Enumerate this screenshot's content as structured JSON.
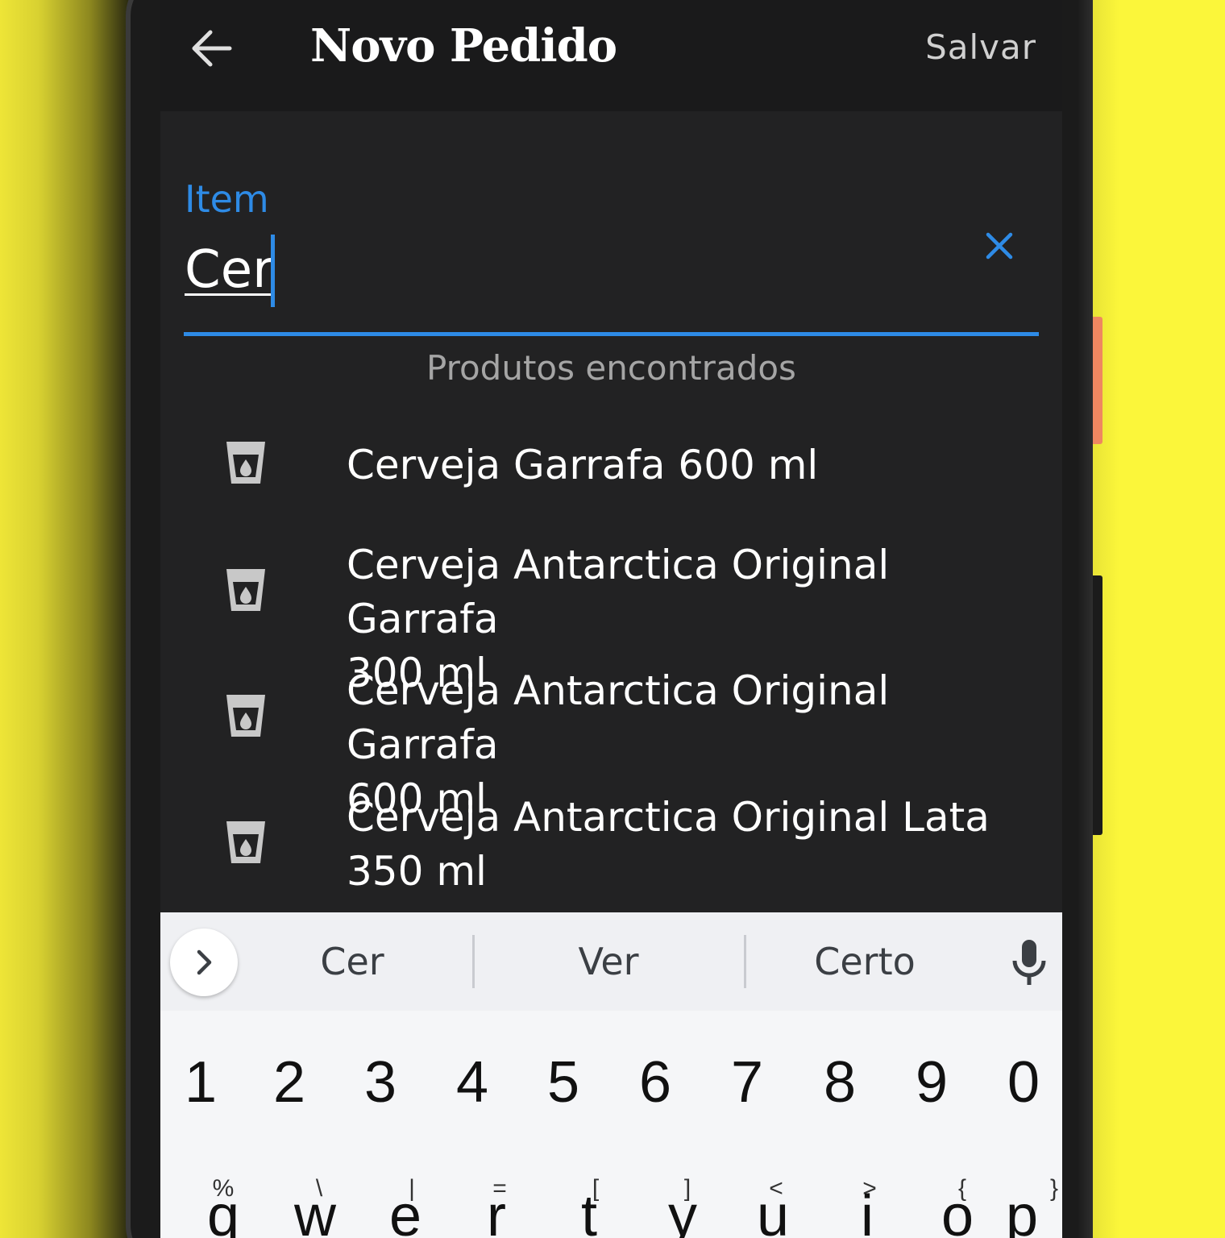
{
  "app": {
    "title": "Novo Pedido",
    "save_label": "Salvar",
    "back_icon": "arrow-left-icon",
    "accent_color": "#2e8be6",
    "background_color": "#fbf63a"
  },
  "search_field": {
    "label": "Item",
    "value": "Cer",
    "clear_icon": "close-icon"
  },
  "results": {
    "heading": "Produtos encontrados",
    "icon": "drink-cup-icon",
    "items": [
      {
        "line1": "Cerveja Garrafa 600 ml",
        "line2": ""
      },
      {
        "line1": "Cerveja Antarctica Original Garrafa",
        "line2": "300 ml"
      },
      {
        "line1": "Cerveja Antarctica Original Garrafa",
        "line2": "600 ml"
      },
      {
        "line1": "Cerveja Antarctica Original Lata",
        "line2": "350 ml"
      }
    ]
  },
  "keyboard": {
    "suggestions": [
      "Cer",
      "Ver",
      "Certo"
    ],
    "expand_icon": "chevron-right-icon",
    "mic_icon": "microphone-icon",
    "number_row": [
      "1",
      "2",
      "3",
      "4",
      "5",
      "6",
      "7",
      "8",
      "9",
      "0"
    ],
    "letter_row": [
      {
        "letter": "q",
        "hint": "%"
      },
      {
        "letter": "w",
        "hint": "\\"
      },
      {
        "letter": "e",
        "hint": "|"
      },
      {
        "letter": "r",
        "hint": "="
      },
      {
        "letter": "t",
        "hint": "["
      },
      {
        "letter": "y",
        "hint": "]"
      },
      {
        "letter": "u",
        "hint": "<"
      },
      {
        "letter": "i",
        "hint": ">"
      },
      {
        "letter": "o",
        "hint": "{"
      },
      {
        "letter": "p",
        "hint": "}"
      }
    ]
  }
}
